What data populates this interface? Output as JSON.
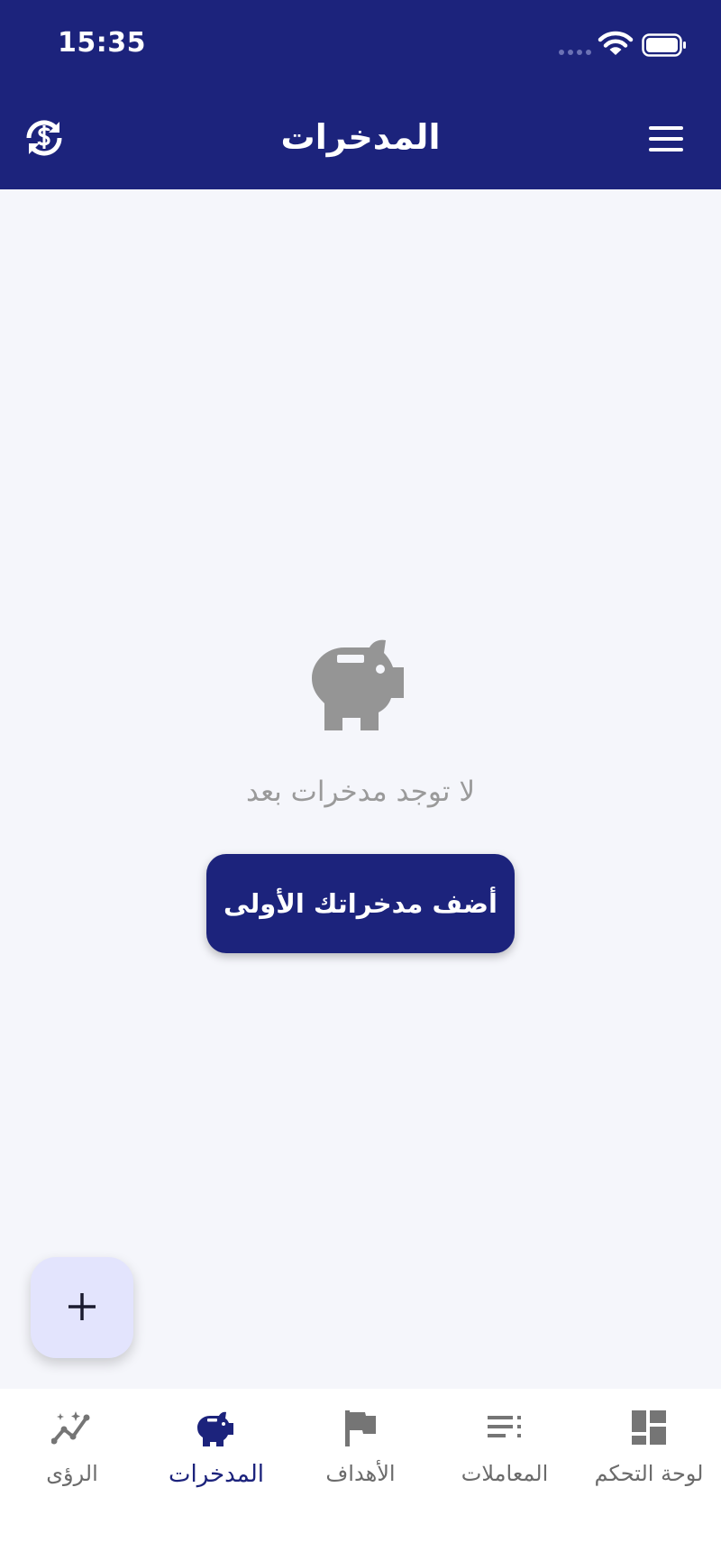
{
  "status_bar": {
    "time": "15:35"
  },
  "header": {
    "title": "المدخرات"
  },
  "empty_state": {
    "message": "لا توجد مدخرات بعد",
    "button_label": "أضف مدخراتك الأولى"
  },
  "fab": {
    "label": "+"
  },
  "bottom_nav": {
    "items": [
      {
        "label": "الرؤى",
        "icon": "insights-icon",
        "active": false
      },
      {
        "label": "المدخرات",
        "icon": "piggy-bank-icon",
        "active": true
      },
      {
        "label": "الأهداف",
        "icon": "flag-icon",
        "active": false
      },
      {
        "label": "المعاملات",
        "icon": "list-icon",
        "active": false
      },
      {
        "label": "لوحة التحكم",
        "icon": "dashboard-icon",
        "active": false
      }
    ]
  },
  "colors": {
    "primary": "#1c237c",
    "background": "#f5f6fb",
    "fab_background": "#e3e4fd",
    "muted_text": "#9a9a9a",
    "icon_gray": "#757575"
  }
}
